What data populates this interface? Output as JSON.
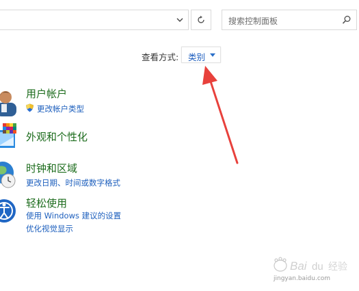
{
  "toolbar": {
    "search_placeholder": "搜索控制面板",
    "refresh_icon": "refresh-icon",
    "dropdown_icon": "chevron-down-icon",
    "search_icon": "search-icon"
  },
  "view_by": {
    "label": "查看方式:",
    "value": "类别"
  },
  "categories": [
    {
      "title": "用户帐户",
      "links": [
        "更改帐户类型"
      ],
      "icon": "user-accounts-icon"
    },
    {
      "title": "外观和个性化",
      "links": [],
      "icon": "appearance-icon"
    },
    {
      "title": "时钟和区域",
      "links": [
        "更改日期、时间或数字格式"
      ],
      "icon": "clock-region-icon"
    },
    {
      "title": "轻松使用",
      "links": [
        "使用 Windows 建议的设置",
        "优化视觉显示"
      ],
      "icon": "ease-of-access-icon"
    }
  ],
  "watermark": {
    "logo_text": "Baidu经验",
    "url": "jingyan.baidu.com"
  },
  "colors": {
    "category_title": "#1b6b1b",
    "link": "#1d5fbd",
    "annotation": "#e8413c"
  }
}
